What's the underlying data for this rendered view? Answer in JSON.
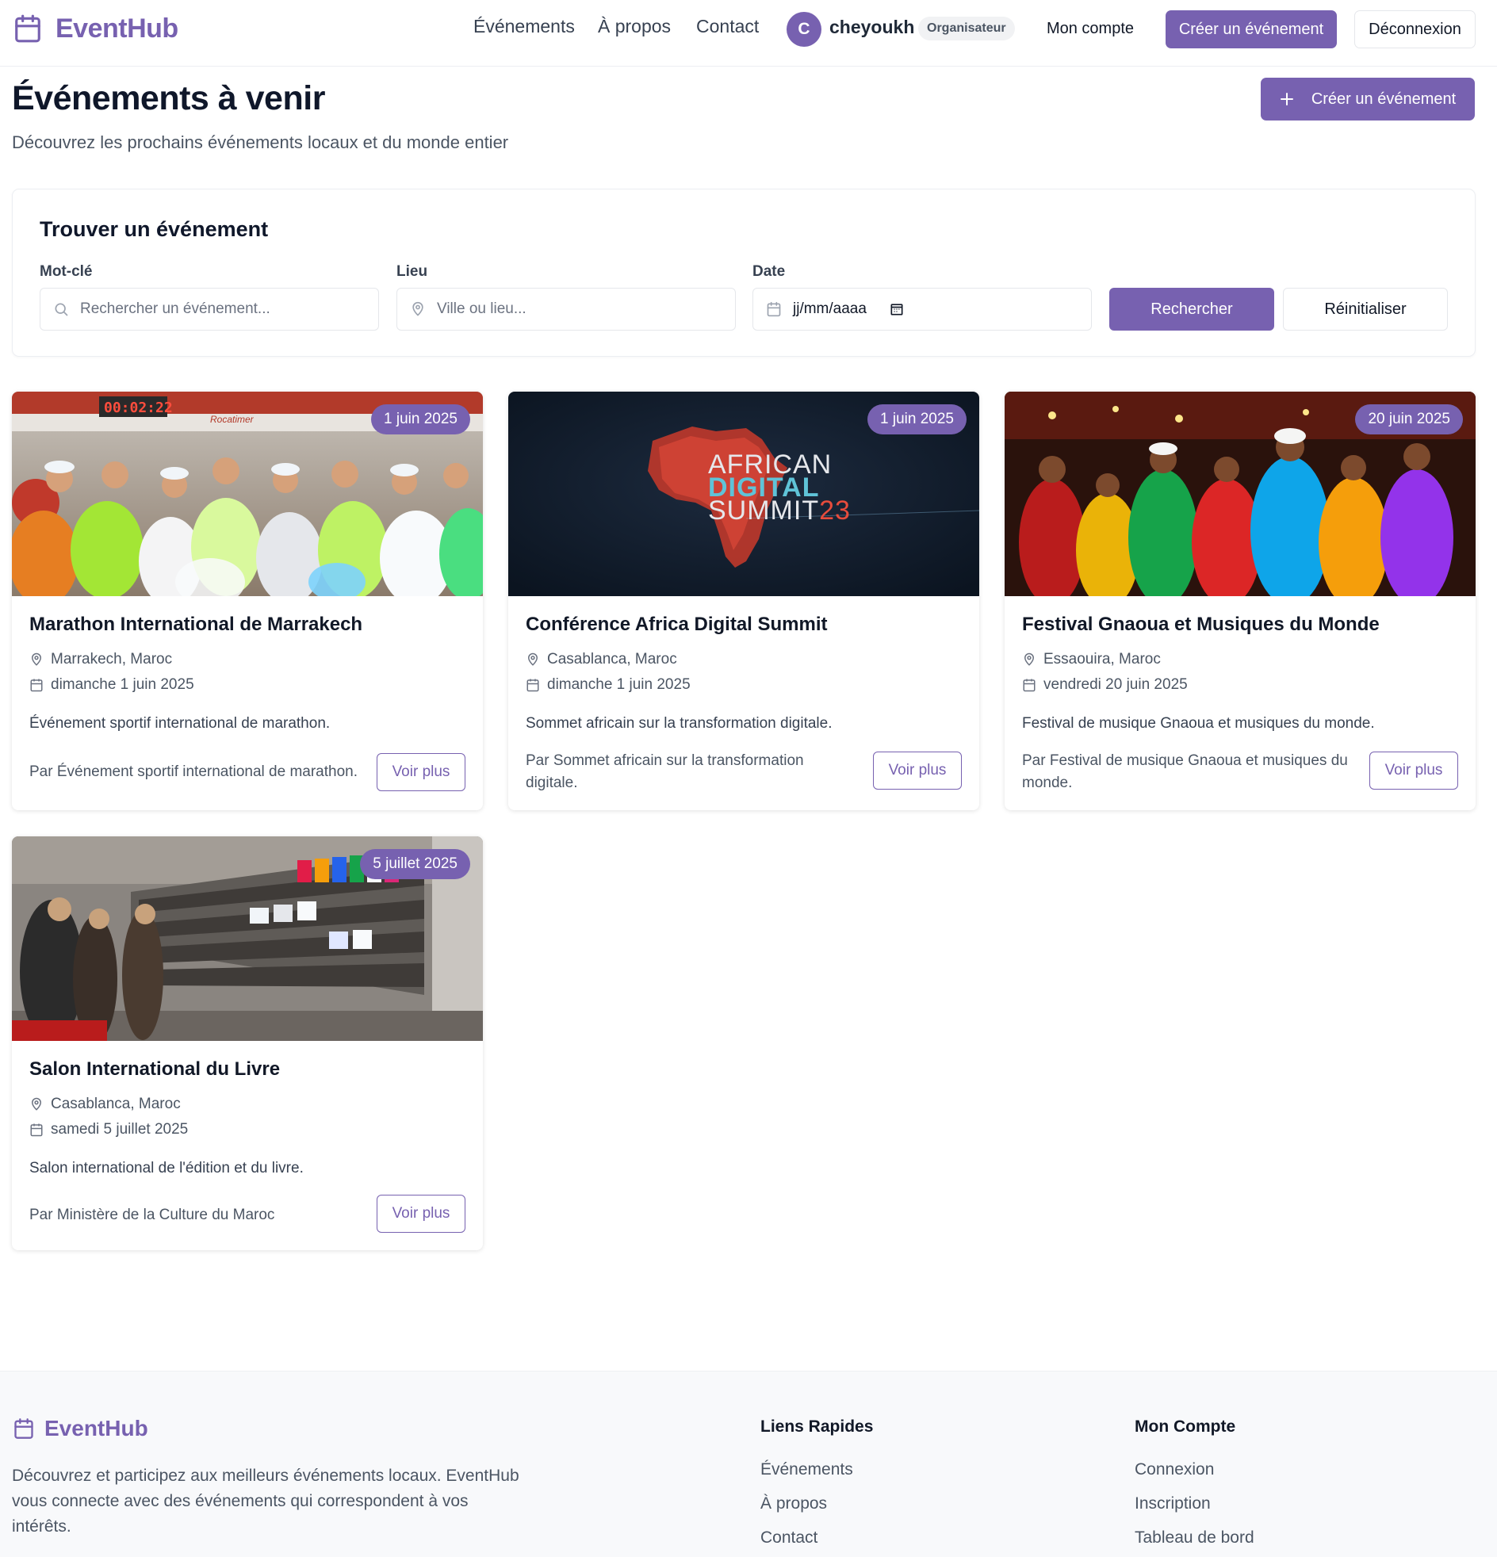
{
  "brand": {
    "name": "EventHub",
    "accent_color": "#7761b0"
  },
  "nav": {
    "links": [
      "Événements",
      "À propos",
      "Contact"
    ],
    "user": {
      "initial": "C",
      "name": "cheyoukh",
      "role": "Organisateur"
    },
    "account_label": "Mon compte",
    "create_label": "Créer un événement",
    "logout_label": "Déconnexion"
  },
  "header": {
    "title": "Événements à venir",
    "subtitle": "Découvrez les prochains événements locaux et du monde entier",
    "create_button": "Créer un événement"
  },
  "search": {
    "title": "Trouver un événement",
    "keyword": {
      "label": "Mot-clé",
      "placeholder": "Rechercher un événement..."
    },
    "location": {
      "label": "Lieu",
      "placeholder": "Ville ou lieu..."
    },
    "date": {
      "label": "Date",
      "value": "jj/mm/aaaa"
    },
    "search_button": "Rechercher",
    "reset_button": "Réinitialiser"
  },
  "events": [
    {
      "badge": "1 juin 2025",
      "title": "Marathon International de Marrakech",
      "location": "Marrakech, Maroc",
      "date": "dimanche 1 juin 2025",
      "description": "Événement sportif international de marathon.",
      "organizer": "Par Événement sportif international de marathon.",
      "button": "Voir plus",
      "image": {
        "clock_text": "00:02:22",
        "banner_text": "Rocatimer"
      }
    },
    {
      "badge": "1 juin 2025",
      "title": "Conférence Africa Digital Summit",
      "location": "Casablanca, Maroc",
      "date": "dimanche 1 juin 2025",
      "description": "Sommet africain sur la transformation digitale.",
      "organizer": "Par Sommet africain sur la transformation digitale.",
      "button": "Voir plus",
      "image": {
        "line1": "AFRICAN",
        "line2": "DIGITAL",
        "line3": "SUMMIT",
        "line3_suffix": "23"
      }
    },
    {
      "badge": "20 juin 2025",
      "title": "Festival Gnaoua et Musiques du Monde",
      "location": "Essaouira, Maroc",
      "date": "vendredi 20 juin 2025",
      "description": "Festival de musique Gnaoua et musiques du monde.",
      "organizer": "Par Festival de musique Gnaoua et musiques du monde.",
      "button": "Voir plus"
    },
    {
      "badge": "5 juillet 2025",
      "title": "Salon International du Livre",
      "location": "Casablanca, Maroc",
      "date": "samedi 5 juillet 2025",
      "description": "Salon international de l'édition et du livre.",
      "organizer": "Par Ministère de la Culture du Maroc",
      "button": "Voir plus"
    }
  ],
  "footer": {
    "brand": "EventHub",
    "description": "Découvrez et participez aux meilleurs événements locaux. EventHub vous connecte avec des événements qui correspondent à vos intérêts.",
    "quick_links": {
      "heading": "Liens Rapides",
      "items": [
        "Événements",
        "À propos",
        "Contact"
      ]
    },
    "account": {
      "heading": "Mon Compte",
      "items": [
        "Connexion",
        "Inscription",
        "Tableau de bord"
      ]
    }
  }
}
